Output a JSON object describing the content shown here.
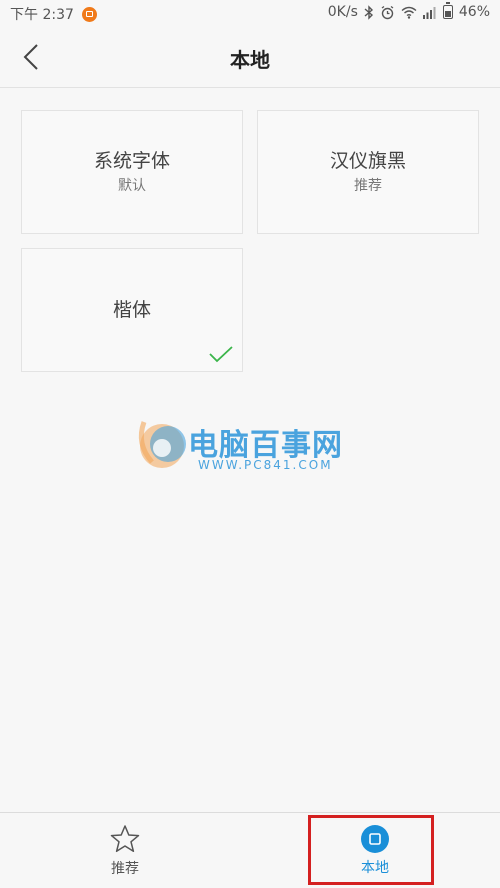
{
  "status_bar": {
    "time": "下午 2:37",
    "network_speed": "0K/s",
    "battery": "46%",
    "battery_level": 0.46
  },
  "header": {
    "title": "本地"
  },
  "fonts": [
    {
      "title": "系统字体",
      "subtitle": "默认",
      "selected": false
    },
    {
      "title": "汉仪旗黑",
      "subtitle": "推荐",
      "selected": false
    },
    {
      "title": "楷体",
      "subtitle": "",
      "selected": true
    }
  ],
  "watermark": {
    "text": "电脑百事网",
    "url": "WWW.PC841.COM"
  },
  "bottom_nav": {
    "tabs": [
      {
        "label": "推荐",
        "icon": "star-icon",
        "active": false
      },
      {
        "label": "本地",
        "icon": "local-icon",
        "active": true
      }
    ]
  },
  "colors": {
    "accent": "#1a8fd8",
    "check": "#3bb54a",
    "highlight": "#d42020",
    "watermark": "#4aa3de"
  }
}
